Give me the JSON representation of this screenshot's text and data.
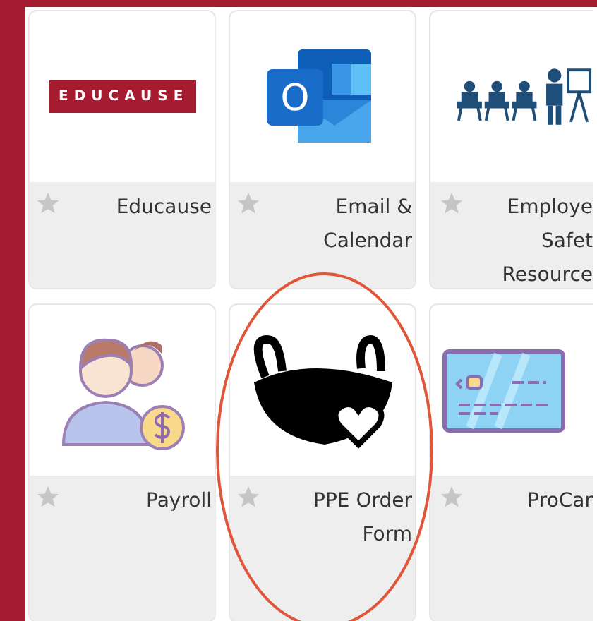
{
  "tiles": [
    {
      "kind": "wordmark",
      "logo_text": "EDUCAUSE",
      "lines": [
        "Educause"
      ],
      "favorite": false,
      "highlighted": false
    },
    {
      "kind": "mail-app",
      "logo_text": "O",
      "lines": [
        "Email &",
        "Calendar"
      ],
      "favorite": false,
      "highlighted": false
    },
    {
      "kind": "training",
      "lines": [
        "Employe",
        "Safet",
        "Resource"
      ],
      "favorite": false,
      "highlighted": false
    },
    {
      "kind": "people-money",
      "lines": [
        "Payroll"
      ],
      "favorite": false,
      "highlighted": false
    },
    {
      "kind": "mask",
      "lines": [
        "PPE Order",
        "Form"
      ],
      "favorite": false,
      "highlighted": true
    },
    {
      "kind": "card",
      "lines": [
        "ProCar"
      ],
      "favorite": false,
      "highlighted": false
    }
  ]
}
